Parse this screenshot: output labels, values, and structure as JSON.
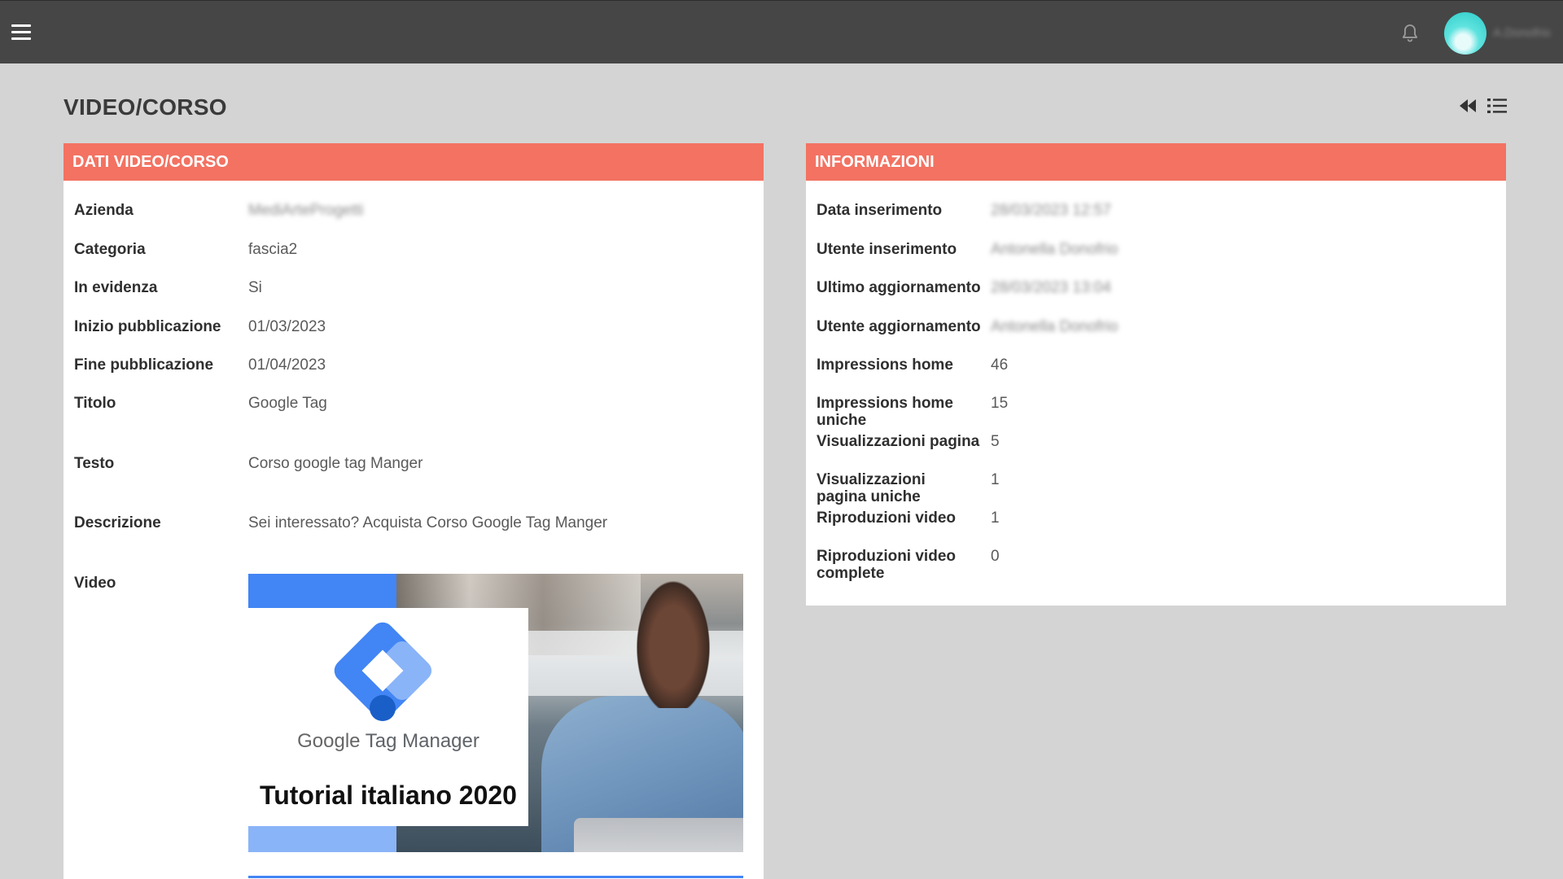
{
  "header": {
    "menu_icon": "hamburger-icon",
    "notification_icon": "bell-icon",
    "user_name": "A.Donofrio"
  },
  "page": {
    "title": "VIDEO/CORSO",
    "tools": [
      {
        "icon": "fast-backward-icon"
      },
      {
        "icon": "list-icon"
      }
    ]
  },
  "left_panel": {
    "title": "DATI VIDEO/CORSO",
    "rows": {
      "azienda": {
        "label": "Azienda",
        "value": "MediArteProgetti"
      },
      "categoria": {
        "label": "Categoria",
        "value": "fascia2"
      },
      "in_evidenza": {
        "label": "In evidenza",
        "value": "Si"
      },
      "inizio": {
        "label": "Inizio pubblicazione",
        "value": "01/03/2023"
      },
      "fine": {
        "label": "Fine pubblicazione",
        "value": "01/04/2023"
      },
      "titolo": {
        "label": "Titolo",
        "value": "Google Tag"
      },
      "testo": {
        "label": "Testo",
        "value": "Corso google tag Manger"
      },
      "descrizione": {
        "label": "Descrizione",
        "value": "Sei interessato? Acquista Corso Google Tag Manger"
      },
      "video": {
        "label": "Video"
      }
    },
    "video_thumbnail": {
      "brand_google": "Google",
      "brand_product": " Tag Manager",
      "subtitle": "Tutorial italiano 2020"
    }
  },
  "right_panel": {
    "title": "INFORMAZIONI",
    "rows": {
      "data_ins": {
        "label": "Data inserimento",
        "value": "28/03/2023 12:57"
      },
      "utente_ins": {
        "label": "Utente inserimento",
        "value": "Antonella Donofrio"
      },
      "ultimo_agg": {
        "label": "Ultimo aggiornamento",
        "value": "28/03/2023 13:04"
      },
      "utente_agg": {
        "label": "Utente aggiornamento",
        "value": "Antonella Donofrio"
      },
      "impr_home": {
        "label": "Impressions home",
        "value": "46"
      },
      "impr_home_uniche": {
        "label": "Impressions home uniche",
        "value": "15"
      },
      "vis_pagina": {
        "label": "Visualizzazioni pagina",
        "value": "5"
      },
      "vis_pagina_uniche": {
        "label": "Visualizzazioni pagina uniche",
        "value": "1"
      },
      "ripr_video": {
        "label": "Riproduzioni video",
        "value": "1"
      },
      "ripr_video_complete": {
        "label": "Riproduzioni video complete",
        "value": "0"
      }
    }
  },
  "colors": {
    "topbar": "#464646",
    "panel_header": "#f37262",
    "background": "#d4d4d4",
    "gtm_blue": "#4285f4",
    "gtm_light_blue": "#8ab4f8"
  }
}
